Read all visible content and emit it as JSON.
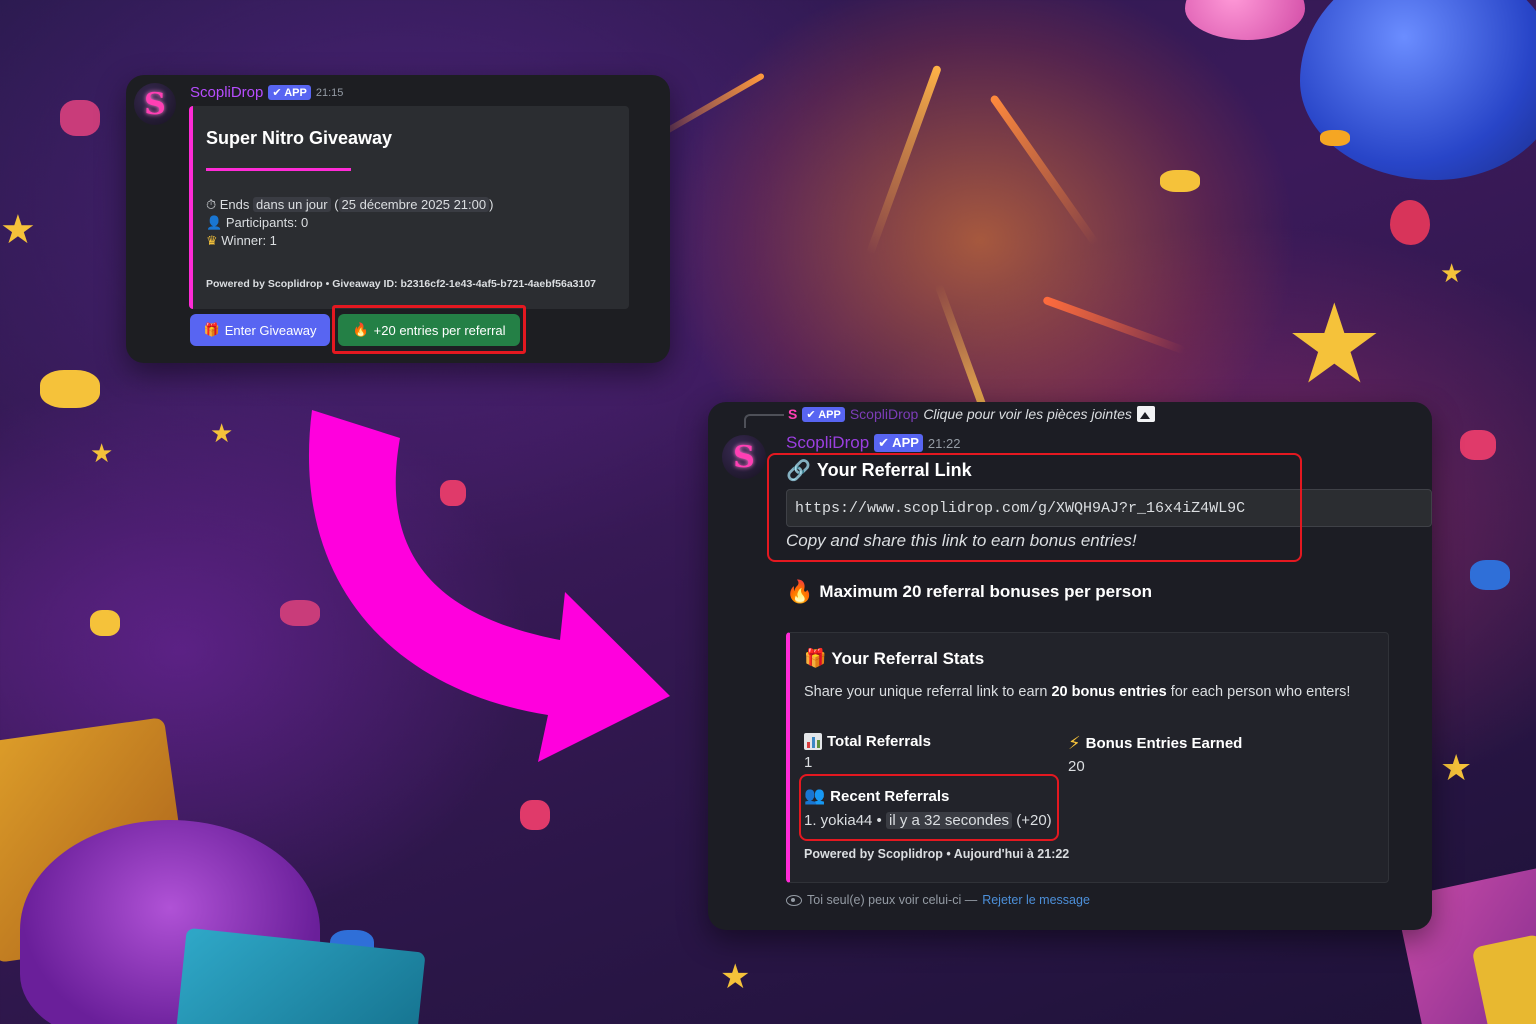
{
  "card1": {
    "username": "ScopliDrop",
    "app_badge": "✔ APP",
    "time": "21:15",
    "embed_title": "Super Nitro Giveaway",
    "ends_prefix": "Ends",
    "ends_relative": "dans un jour",
    "ends_absolute": "25 décembre 2025 21:00",
    "participants": "Participants: 0",
    "winner": "Winner: 1",
    "footer": "Powered by Scoplidrop • Giveaway ID: b2316cf2-1e43-4af5-b721-4aebf56a3107",
    "enter_button": "Enter Giveaway",
    "referral_button": "+20 entries per referral"
  },
  "card2": {
    "reply_username": "ScopliDrop",
    "reply_text": "Clique pour voir les pièces jointes",
    "app_badge": "✔ APP",
    "username": "ScopliDrop",
    "time": "21:22",
    "link_heading": "Your Referral Link",
    "link_url": "https://www.scoplidrop.com/g/XWQH9AJ?r_16x4iZ4WL9C",
    "link_caption": "Copy and share this link to earn bonus entries!",
    "max_notice": "Maximum 20 referral bonuses per person",
    "stats_title": "Your Referral Stats",
    "stats_desc_pre": "Share your unique referral link to earn ",
    "stats_desc_bold": "20 bonus entries",
    "stats_desc_post": " for each person who enters!",
    "total_label": "Total Referrals",
    "total_value": "1",
    "bonus_label": "Bonus Entries Earned",
    "bonus_value": "20",
    "recent_label": "Recent Referrals",
    "recent_item_name": "1. yokia44 •",
    "recent_item_time": "il y a 32 secondes",
    "recent_item_bonus": "(+20)",
    "footer": "Powered by Scoplidrop • Aujourd'hui à 21:22",
    "ephemeral_text": "Toi seul(e) peux voir celui-ci —",
    "dismiss_link": "Rejeter le message"
  },
  "colors": {
    "accent_pink": "#ff2bd6",
    "arrow_magenta": "#ff00dd",
    "blurple": "#5865f2",
    "green": "#248046",
    "highlight_red": "#e41820"
  }
}
